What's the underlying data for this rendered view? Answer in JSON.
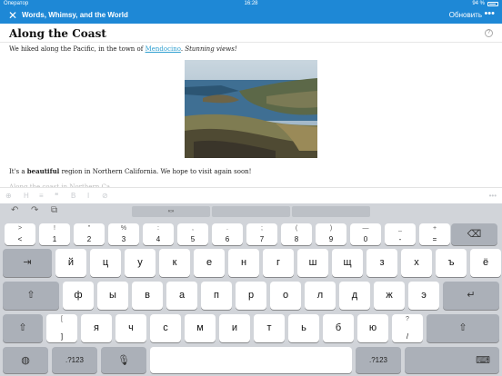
{
  "status": {
    "carrier": "Оператор",
    "time": "16:28",
    "battery": "94 %"
  },
  "appbar": {
    "title": "Words, Whimsy, and the World",
    "update": "Обновить",
    "more": "•••",
    "close": "✕"
  },
  "post": {
    "title": "Along the Coast",
    "para1_before": "We hiked along the Pacific, in the town of ",
    "para1_link": "Mendocino",
    "para1_after_period": ". ",
    "para1_italic": "Stunning views!",
    "para2_before": "It's a ",
    "para2_bold": "beautiful",
    "para2_after": " region in Northern California. We hope to visit again soon!",
    "para3": "Along the coast in Northern Ca..."
  },
  "format_toolbar": [
    "⊕",
    "H",
    "≡",
    "❝",
    "B",
    "I",
    "⊘",
    "•••"
  ],
  "keyboard": {
    "suggestions": [
      "«»",
      "",
      ""
    ],
    "number_row": [
      {
        "t": ">",
        "b": "<"
      },
      {
        "t": "!",
        "b": "1"
      },
      {
        "t": "\"",
        "b": "2"
      },
      {
        "t": "%",
        "b": "3"
      },
      {
        "t": ":",
        "b": "4"
      },
      {
        "t": ",",
        "b": "5"
      },
      {
        "t": ".",
        "b": "6"
      },
      {
        "t": ";",
        "b": "7"
      },
      {
        "t": "(",
        "b": "8"
      },
      {
        "t": ")",
        "b": "9"
      },
      {
        "t": "—",
        "b": "0"
      },
      {
        "t": "_",
        "b": "-"
      },
      {
        "t": "+",
        "b": "="
      }
    ],
    "row1": [
      "й",
      "ц",
      "у",
      "к",
      "е",
      "н",
      "г",
      "ш",
      "щ",
      "з",
      "х",
      "ъ",
      "ё"
    ],
    "row2": [
      "ф",
      "ы",
      "в",
      "а",
      "п",
      "р",
      "о",
      "л",
      "д",
      "ж",
      "э"
    ],
    "row3_punct": {
      "t": "[",
      "b": "]"
    },
    "row3": [
      "я",
      "ч",
      "с",
      "м",
      "и",
      "т",
      "ь",
      "б",
      "ю"
    ],
    "row3_end": {
      "t": "?",
      "b": "/"
    },
    "tab": "⇥",
    "shift": "⇧",
    "backspace": "⌫",
    "return": "↵",
    "globe": "◍",
    "num123": ".?123",
    "mic": "🎙",
    "hide": "⌨"
  }
}
